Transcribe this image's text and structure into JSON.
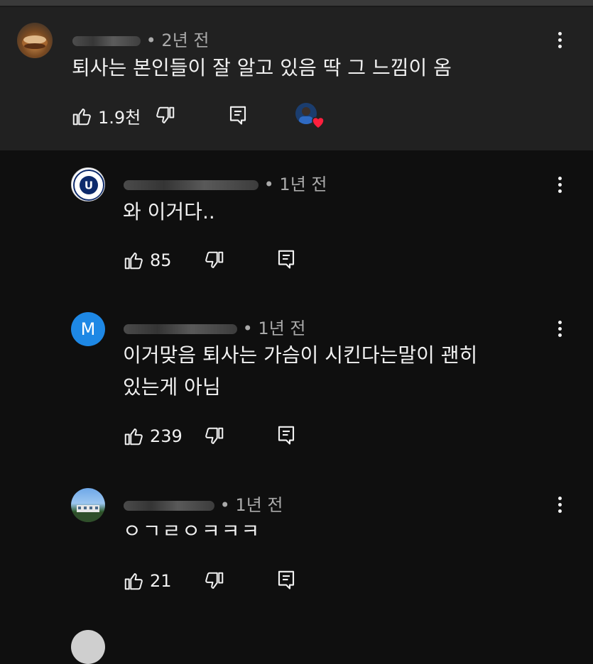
{
  "colors": {
    "background": "#0f0f0f",
    "highlight_background": "#212121",
    "meta_text": "#aaaaaa",
    "text": "#f1f1f1",
    "heart": "#ff1f3d",
    "m_avatar": "#1e88e5",
    "u_badge": "#0d2a6b"
  },
  "comments": [
    {
      "author_avatar": "food-photo-avatar",
      "time": "• 2년 전",
      "text": "퇴사는 본인들이 잘 알고 있음  딱 그 느낌이 옴",
      "likes": "1.9천",
      "creator_heart": true
    },
    {
      "author_avatar": "university-badge-avatar",
      "avatar_letter": "U",
      "time": "• 1년 전",
      "text": "와 이거다..",
      "likes": "85"
    },
    {
      "author_avatar": "letter-avatar",
      "avatar_letter": "M",
      "time": "• 1년 전",
      "text_lines": [
        "이거맞음 퇴사는 가슴이 시킨다는말이 괜히",
        "있는게 아님"
      ],
      "likes": "239"
    },
    {
      "author_avatar": "landscape-photo-avatar",
      "time": "• 1년 전",
      "text": "ㅇㄱㄹㅇㅋㅋㅋ",
      "likes": "21"
    }
  ],
  "icons": {
    "like": "thumbs-up-icon",
    "dislike": "thumbs-down-icon",
    "reply": "reply-icon",
    "more": "more-vert-icon",
    "heart": "heart-icon"
  }
}
